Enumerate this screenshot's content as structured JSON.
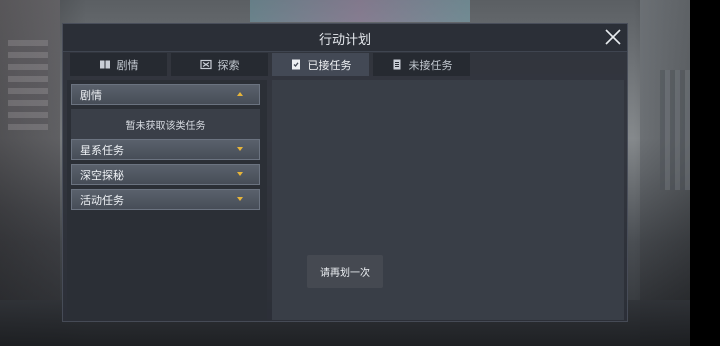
{
  "window": {
    "title": "行动计划"
  },
  "tabs": [
    {
      "label": "剧情",
      "icon": "book-icon"
    },
    {
      "label": "探索",
      "icon": "explore-icon"
    },
    {
      "label": "已接任务",
      "icon": "accepted-task-icon",
      "active": true
    },
    {
      "label": "未接任务",
      "icon": "clipboard-icon"
    }
  ],
  "categories": [
    {
      "label": "剧情",
      "expanded": true
    },
    {
      "label": "星系任务",
      "expanded": false
    },
    {
      "label": "深空探秘",
      "expanded": false
    },
    {
      "label": "活动任务",
      "expanded": false
    }
  ],
  "empty_message": "暂未获取该类任务",
  "toast": "请再划一次",
  "colors": {
    "accent": "#e7b53a",
    "panel_bg": "#2c3038",
    "active_tab": "#434955"
  }
}
